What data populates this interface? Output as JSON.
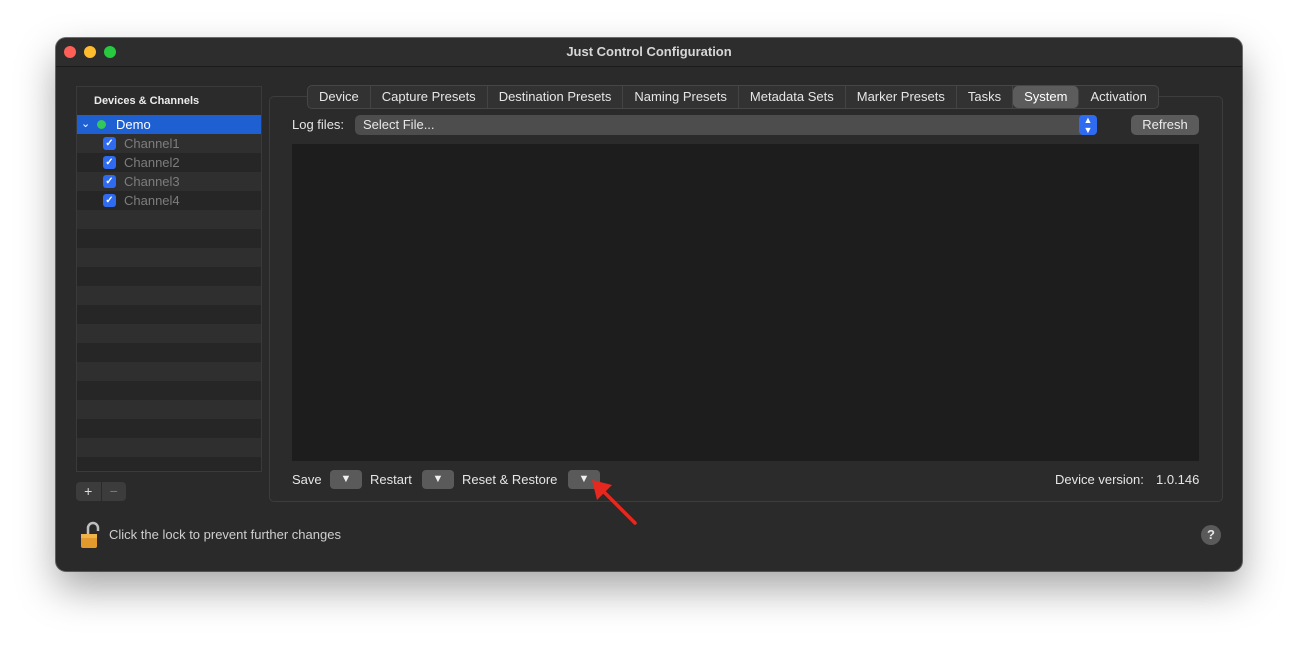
{
  "window": {
    "title": "Just Control Configuration"
  },
  "sidebar": {
    "header": "Devices & Channels",
    "device": {
      "label": "Demo",
      "chevron": "⌄",
      "status_color": "#34c759"
    },
    "channels": [
      {
        "label": "Channel1",
        "checked": true
      },
      {
        "label": "Channel2",
        "checked": true
      },
      {
        "label": "Channel3",
        "checked": true
      },
      {
        "label": "Channel4",
        "checked": true
      }
    ],
    "add_label": "+",
    "remove_label": "−"
  },
  "tabs": [
    {
      "label": "Device",
      "active": false
    },
    {
      "label": "Capture Presets",
      "active": false
    },
    {
      "label": "Destination Presets",
      "active": false
    },
    {
      "label": "Naming Presets",
      "active": false
    },
    {
      "label": "Metadata Sets",
      "active": false
    },
    {
      "label": "Marker Presets",
      "active": false
    },
    {
      "label": "Tasks",
      "active": false
    },
    {
      "label": "System",
      "active": true
    },
    {
      "label": "Activation",
      "active": false
    }
  ],
  "system": {
    "log_files_label": "Log files:",
    "select_value": "Select File...",
    "refresh_label": "Refresh",
    "save_label": "Save",
    "restart_label": "Restart",
    "reset_restore_label": "Reset & Restore",
    "dropdown_glyph": "▼",
    "device_version_label": "Device version:",
    "device_version_value": "1.0.146"
  },
  "footer": {
    "lock_text": "Click the lock to prevent further changes",
    "help_label": "?"
  },
  "colors": {
    "accent": "#2f6bf0",
    "selection": "#1e5fd1",
    "annotation_arrow": "#e8281e"
  }
}
